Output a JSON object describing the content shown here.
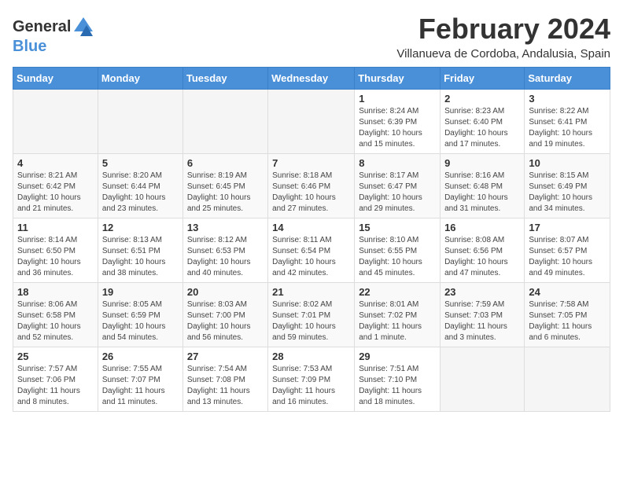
{
  "logo": {
    "general": "General",
    "blue": "Blue"
  },
  "title": "February 2024",
  "subtitle": "Villanueva de Cordoba, Andalusia, Spain",
  "days": [
    "Sunday",
    "Monday",
    "Tuesday",
    "Wednesday",
    "Thursday",
    "Friday",
    "Saturday"
  ],
  "weeks": [
    [
      {
        "day": "",
        "info": ""
      },
      {
        "day": "",
        "info": ""
      },
      {
        "day": "",
        "info": ""
      },
      {
        "day": "",
        "info": ""
      },
      {
        "day": "1",
        "info": "Sunrise: 8:24 AM\nSunset: 6:39 PM\nDaylight: 10 hours\nand 15 minutes."
      },
      {
        "day": "2",
        "info": "Sunrise: 8:23 AM\nSunset: 6:40 PM\nDaylight: 10 hours\nand 17 minutes."
      },
      {
        "day": "3",
        "info": "Sunrise: 8:22 AM\nSunset: 6:41 PM\nDaylight: 10 hours\nand 19 minutes."
      }
    ],
    [
      {
        "day": "4",
        "info": "Sunrise: 8:21 AM\nSunset: 6:42 PM\nDaylight: 10 hours\nand 21 minutes."
      },
      {
        "day": "5",
        "info": "Sunrise: 8:20 AM\nSunset: 6:44 PM\nDaylight: 10 hours\nand 23 minutes."
      },
      {
        "day": "6",
        "info": "Sunrise: 8:19 AM\nSunset: 6:45 PM\nDaylight: 10 hours\nand 25 minutes."
      },
      {
        "day": "7",
        "info": "Sunrise: 8:18 AM\nSunset: 6:46 PM\nDaylight: 10 hours\nand 27 minutes."
      },
      {
        "day": "8",
        "info": "Sunrise: 8:17 AM\nSunset: 6:47 PM\nDaylight: 10 hours\nand 29 minutes."
      },
      {
        "day": "9",
        "info": "Sunrise: 8:16 AM\nSunset: 6:48 PM\nDaylight: 10 hours\nand 31 minutes."
      },
      {
        "day": "10",
        "info": "Sunrise: 8:15 AM\nSunset: 6:49 PM\nDaylight: 10 hours\nand 34 minutes."
      }
    ],
    [
      {
        "day": "11",
        "info": "Sunrise: 8:14 AM\nSunset: 6:50 PM\nDaylight: 10 hours\nand 36 minutes."
      },
      {
        "day": "12",
        "info": "Sunrise: 8:13 AM\nSunset: 6:51 PM\nDaylight: 10 hours\nand 38 minutes."
      },
      {
        "day": "13",
        "info": "Sunrise: 8:12 AM\nSunset: 6:53 PM\nDaylight: 10 hours\nand 40 minutes."
      },
      {
        "day": "14",
        "info": "Sunrise: 8:11 AM\nSunset: 6:54 PM\nDaylight: 10 hours\nand 42 minutes."
      },
      {
        "day": "15",
        "info": "Sunrise: 8:10 AM\nSunset: 6:55 PM\nDaylight: 10 hours\nand 45 minutes."
      },
      {
        "day": "16",
        "info": "Sunrise: 8:08 AM\nSunset: 6:56 PM\nDaylight: 10 hours\nand 47 minutes."
      },
      {
        "day": "17",
        "info": "Sunrise: 8:07 AM\nSunset: 6:57 PM\nDaylight: 10 hours\nand 49 minutes."
      }
    ],
    [
      {
        "day": "18",
        "info": "Sunrise: 8:06 AM\nSunset: 6:58 PM\nDaylight: 10 hours\nand 52 minutes."
      },
      {
        "day": "19",
        "info": "Sunrise: 8:05 AM\nSunset: 6:59 PM\nDaylight: 10 hours\nand 54 minutes."
      },
      {
        "day": "20",
        "info": "Sunrise: 8:03 AM\nSunset: 7:00 PM\nDaylight: 10 hours\nand 56 minutes."
      },
      {
        "day": "21",
        "info": "Sunrise: 8:02 AM\nSunset: 7:01 PM\nDaylight: 10 hours\nand 59 minutes."
      },
      {
        "day": "22",
        "info": "Sunrise: 8:01 AM\nSunset: 7:02 PM\nDaylight: 11 hours\nand 1 minute."
      },
      {
        "day": "23",
        "info": "Sunrise: 7:59 AM\nSunset: 7:03 PM\nDaylight: 11 hours\nand 3 minutes."
      },
      {
        "day": "24",
        "info": "Sunrise: 7:58 AM\nSunset: 7:05 PM\nDaylight: 11 hours\nand 6 minutes."
      }
    ],
    [
      {
        "day": "25",
        "info": "Sunrise: 7:57 AM\nSunset: 7:06 PM\nDaylight: 11 hours\nand 8 minutes."
      },
      {
        "day": "26",
        "info": "Sunrise: 7:55 AM\nSunset: 7:07 PM\nDaylight: 11 hours\nand 11 minutes."
      },
      {
        "day": "27",
        "info": "Sunrise: 7:54 AM\nSunset: 7:08 PM\nDaylight: 11 hours\nand 13 minutes."
      },
      {
        "day": "28",
        "info": "Sunrise: 7:53 AM\nSunset: 7:09 PM\nDaylight: 11 hours\nand 16 minutes."
      },
      {
        "day": "29",
        "info": "Sunrise: 7:51 AM\nSunset: 7:10 PM\nDaylight: 11 hours\nand 18 minutes."
      },
      {
        "day": "",
        "info": ""
      },
      {
        "day": "",
        "info": ""
      }
    ]
  ]
}
